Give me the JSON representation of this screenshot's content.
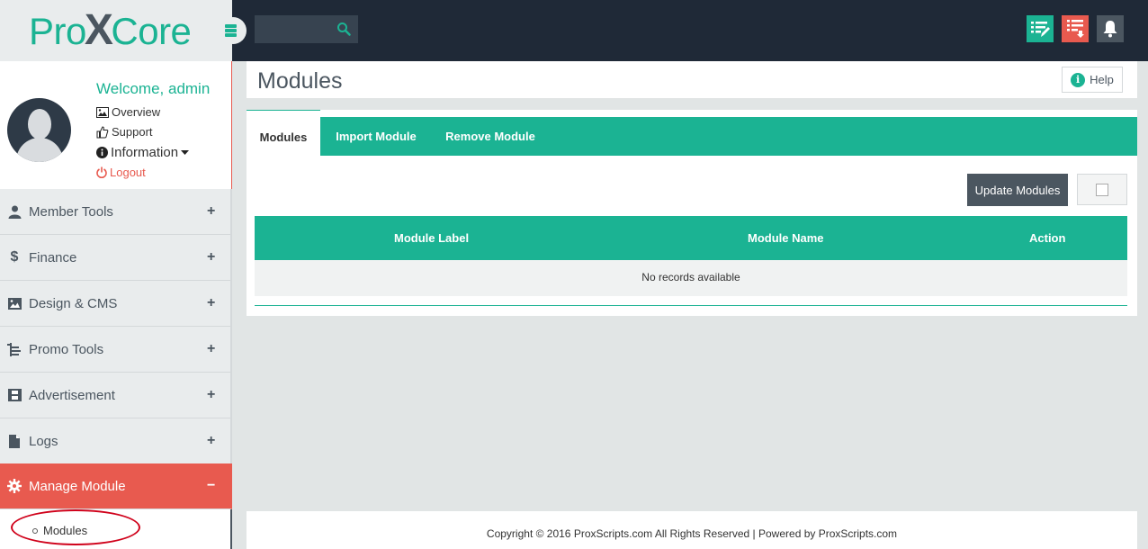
{
  "brand": {
    "logo_left": "Pro",
    "logo_x": "X",
    "logo_right": "Core",
    "accent_color": "#1bb393",
    "danger_color": "#e85a4f",
    "dark_color": "#1f2937"
  },
  "topbar": {
    "search": {
      "placeholder": "",
      "icon": "search-icon"
    },
    "buttons": [
      {
        "icon": "edit-list-icon",
        "color": "#1bb393"
      },
      {
        "icon": "download-list-icon",
        "color": "#e85a4f"
      },
      {
        "icon": "bell-icon",
        "color": "#4b5660"
      }
    ]
  },
  "profile": {
    "welcome": "Welcome, admin",
    "links": {
      "overview": "Overview",
      "support": "Support",
      "information": "Information",
      "logout": "Logout"
    }
  },
  "sidebar": {
    "items": [
      {
        "label": "Member Tools",
        "icon": "user-icon",
        "toggle": "+"
      },
      {
        "label": "Finance",
        "icon": "dollar-icon",
        "toggle": "+"
      },
      {
        "label": "Design & CMS",
        "icon": "image-icon",
        "toggle": "+"
      },
      {
        "label": "Promo Tools",
        "icon": "tree-icon",
        "toggle": "+"
      },
      {
        "label": "Advertisement",
        "icon": "film-icon",
        "toggle": "+"
      },
      {
        "label": "Logs",
        "icon": "file-icon",
        "toggle": "+"
      },
      {
        "label": "Manage Module",
        "icon": "gear-icon",
        "toggle": "−",
        "active": true
      }
    ],
    "submenu": [
      {
        "label": "Modules"
      }
    ]
  },
  "page": {
    "title": "Modules",
    "help_label": "Help"
  },
  "tabs": [
    {
      "label": "Modules",
      "active": true
    },
    {
      "label": "Import Module"
    },
    {
      "label": "Remove Module"
    }
  ],
  "toolbar": {
    "update_label": "Update Modules"
  },
  "table": {
    "columns": [
      "Module Label",
      "Module Name",
      "Action"
    ],
    "empty_text": "No records available"
  },
  "footer": {
    "text": "Copyright © 2016 ProxScripts.com All Rights Reserved | Powered by ProxScripts.com"
  }
}
